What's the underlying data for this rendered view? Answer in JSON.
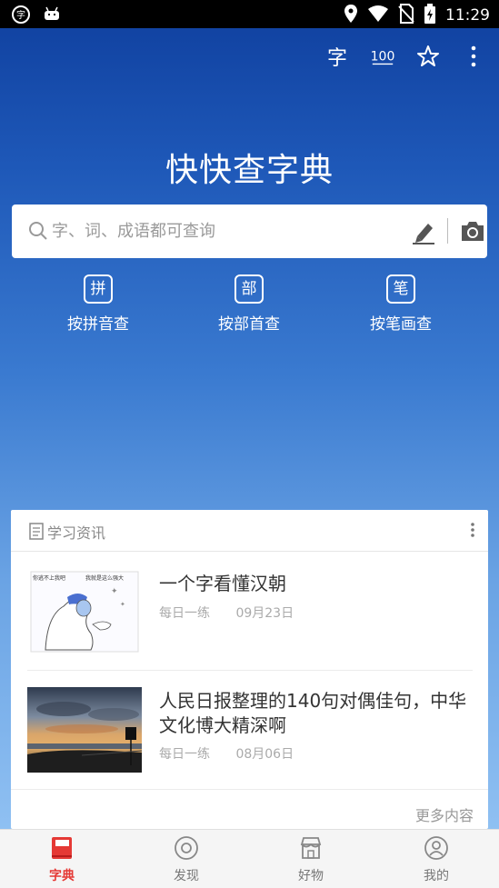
{
  "statusbar": {
    "time": "11:29",
    "icons": [
      "app-icon",
      "android-icon",
      "location-icon",
      "wifi-icon",
      "no-sim-icon",
      "battery-icon"
    ]
  },
  "toolbar": {
    "icons": [
      "zi-icon",
      "hundred-icon",
      "star-icon",
      "more-vert-icon"
    ],
    "zi_label": "字",
    "hundred_label": "100"
  },
  "app": {
    "title": "快快查字典"
  },
  "search": {
    "placeholder": "字、词、成语都可查询",
    "value": ""
  },
  "modes": [
    {
      "badge": "拼",
      "label": "按拼音查"
    },
    {
      "badge": "部",
      "label": "按部首查"
    },
    {
      "badge": "笔",
      "label": "按笔画查"
    }
  ],
  "card": {
    "title": "学习资讯",
    "items": [
      {
        "title": "一个字看懂汉朝",
        "category": "每日一练",
        "date": "09月23日",
        "thumb_text_left": "你逃不上我吧",
        "thumb_text_right": "我就是这么强大"
      },
      {
        "title": "人民日报整理的140句对偶佳句，中华文化博大精深啊",
        "category": "每日一练",
        "date": "08月06日"
      }
    ],
    "more": "更多内容"
  },
  "tabs": [
    {
      "label": "字典",
      "active": true
    },
    {
      "label": "发现",
      "active": false
    },
    {
      "label": "好物",
      "active": false
    },
    {
      "label": "我的",
      "active": false
    }
  ],
  "colors": {
    "accent": "#e53935",
    "bg_top": "#0f3f9e",
    "bg_bottom": "#8fc0f2"
  }
}
